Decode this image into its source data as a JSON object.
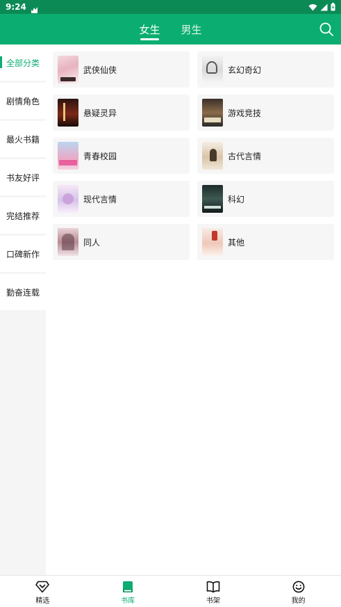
{
  "status_bar": {
    "time": "9:24"
  },
  "header": {
    "tabs": [
      {
        "label": "女生",
        "active": true
      },
      {
        "label": "男生",
        "active": false
      }
    ]
  },
  "sidebar": {
    "items": [
      {
        "label": "全部分类",
        "active": true
      },
      {
        "label": "剧情角色",
        "active": false
      },
      {
        "label": "最火书籍",
        "active": false
      },
      {
        "label": "书友好评",
        "active": false
      },
      {
        "label": "完结推荐",
        "active": false
      },
      {
        "label": "口碑新作",
        "active": false
      },
      {
        "label": "勤奋连载",
        "active": false
      }
    ]
  },
  "categories": [
    {
      "label": "武侠仙侠"
    },
    {
      "label": "玄幻奇幻"
    },
    {
      "label": "悬疑灵异"
    },
    {
      "label": "游戏竞技"
    },
    {
      "label": "青春校园"
    },
    {
      "label": "古代言情"
    },
    {
      "label": "现代言情"
    },
    {
      "label": "科幻"
    },
    {
      "label": "同人"
    },
    {
      "label": "其他"
    }
  ],
  "bottom_nav": {
    "items": [
      {
        "label": "精选",
        "icon": "diamond-icon",
        "active": false
      },
      {
        "label": "书库",
        "icon": "book-icon",
        "active": true
      },
      {
        "label": "书架",
        "icon": "open-book-icon",
        "active": false
      },
      {
        "label": "我的",
        "icon": "smiley-icon",
        "active": false
      }
    ]
  },
  "colors": {
    "accent": "#0bae70",
    "status_bar": "#0c8a55",
    "card_bg": "#f6f6f6",
    "sidebar_bg": "#f5f5f5"
  }
}
